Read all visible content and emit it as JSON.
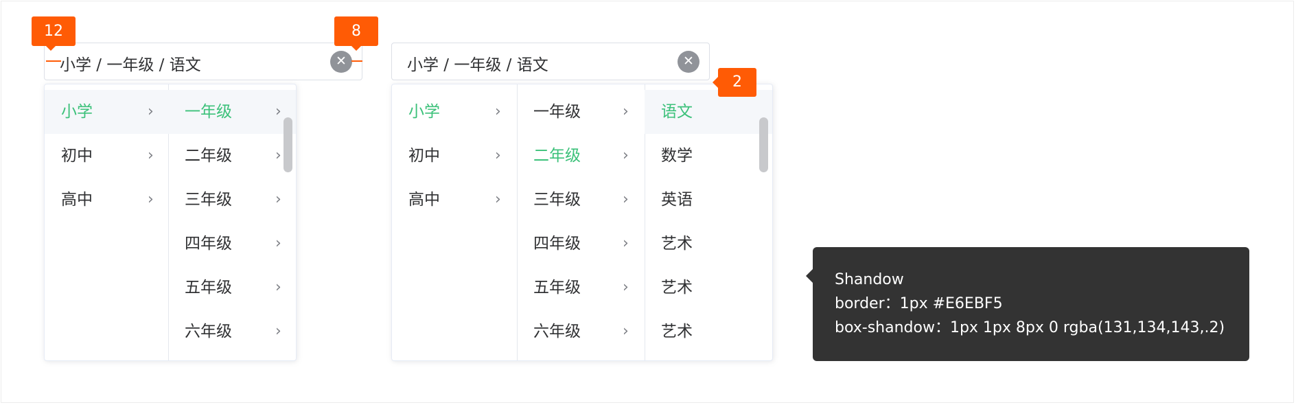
{
  "cascader_left": {
    "input_value": "小学 / 一年级 / 语文",
    "clear_icon": "close-circle-icon",
    "menu_level1": [
      {
        "label": "小学",
        "selected": true
      },
      {
        "label": "初中",
        "selected": false
      },
      {
        "label": "高中",
        "selected": false
      }
    ],
    "menu_level2": [
      {
        "label": "一年级",
        "selected": true
      },
      {
        "label": "二年级",
        "selected": false
      },
      {
        "label": "三年级",
        "selected": false
      },
      {
        "label": "四年级",
        "selected": false
      },
      {
        "label": "五年级",
        "selected": false
      },
      {
        "label": "六年级",
        "selected": false
      }
    ]
  },
  "cascader_right": {
    "input_value": "小学 / 一年级 / 语文",
    "clear_icon": "close-circle-icon",
    "menu_level1": [
      {
        "label": "小学",
        "selected": true
      },
      {
        "label": "初中",
        "selected": false
      },
      {
        "label": "高中",
        "selected": false
      }
    ],
    "menu_level2": [
      {
        "label": "一年级",
        "selected": false
      },
      {
        "label": "二年级",
        "selected": true
      },
      {
        "label": "三年级",
        "selected": false
      },
      {
        "label": "四年级",
        "selected": false
      },
      {
        "label": "五年级",
        "selected": false
      },
      {
        "label": "六年级",
        "selected": false
      }
    ],
    "menu_level3": [
      {
        "label": "语文",
        "selected": true
      },
      {
        "label": "数学",
        "selected": false
      },
      {
        "label": "英语",
        "selected": false
      },
      {
        "label": "艺术",
        "selected": false
      },
      {
        "label": "艺术",
        "selected": false
      },
      {
        "label": "艺术",
        "selected": false
      }
    ]
  },
  "annotations": {
    "padding_left": "12",
    "padding_right": "8",
    "panel_gap": "2"
  },
  "tooltip": {
    "title": "Shandow",
    "line1": "border：1px #E6EBF5",
    "line2": "box-shandow：1px 1px 8px 0 rgba(131,134,143,.2)"
  },
  "colors": {
    "selected_text": "#3cc17a",
    "annotation": "#ff5b05",
    "tooltip_bg": "#333333",
    "panel_border": "#E6EBF5"
  },
  "icons": {
    "arrow": "chevron-right-icon",
    "clear": "close-icon"
  }
}
